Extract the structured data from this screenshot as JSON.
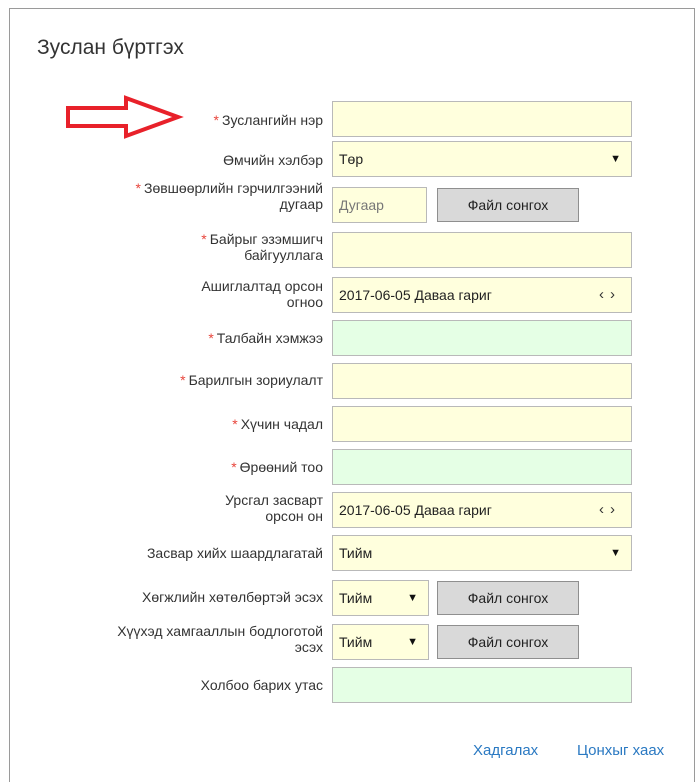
{
  "title": "Зуслан бүртгэх",
  "fields": {
    "name": {
      "label": "Зуслангийн нэр",
      "required": true,
      "value": ""
    },
    "ownership": {
      "label": "Өмчийн хэлбэр",
      "value": "Төр"
    },
    "permit": {
      "label_line1": "Зөвшөөрлийн гэрчилгээний",
      "label_line2": "дугаар",
      "required": true,
      "placeholder": "Дугаар",
      "file_button": "Файл сонгох"
    },
    "holder_org": {
      "label_line1": "Байрыг эзэмшигч",
      "label_line2": "байгууллага",
      "required": true,
      "value": ""
    },
    "commission_date": {
      "label_line1": "Ашиглалтад орсон",
      "label_line2": "огноо",
      "value": "2017-06-05 Даваа гариг"
    },
    "area_size": {
      "label": "Талбайн хэмжээ",
      "required": true,
      "value": ""
    },
    "building_purpose": {
      "label": "Барилгын зориулалт",
      "required": true,
      "value": ""
    },
    "capacity": {
      "label": "Хүчин чадал",
      "required": true,
      "value": ""
    },
    "room_count": {
      "label": "Өрөөний тоо",
      "required": true,
      "value": ""
    },
    "repair_year": {
      "label_line1": "Урсгал засварт",
      "label_line2": "орсон он",
      "value": "2017-06-05 Даваа гариг"
    },
    "repair_needed": {
      "label": "Засвар хийх шаардлагатай",
      "value": "Тийм"
    },
    "dev_program": {
      "label": "Хөгжлийн хөтөлбөртэй эсэх",
      "value": "Тийм",
      "file_button": "Файл сонгох"
    },
    "child_policy": {
      "label_line1": "Хүүхэд хамгааллын бодлоготой",
      "label_line2": "эсэх",
      "value": "Тийм",
      "file_button": "Файл сонгох"
    },
    "phone": {
      "label": "Холбоо барих утас",
      "value": ""
    }
  },
  "footer": {
    "save": "Хадгалах",
    "close": "Цонхыг хаах"
  },
  "icons": {
    "dropdown": "caret-down-icon",
    "prev": "chevron-left-icon",
    "next": "chevron-right-icon",
    "annotation": "red-outline-arrow-icon"
  },
  "colors": {
    "required_field": "#ffffdd",
    "numeric_field": "#e5ffe5",
    "required_star": "#e8453c",
    "link": "#2a79c2",
    "annotation_arrow": "#e8212a"
  }
}
